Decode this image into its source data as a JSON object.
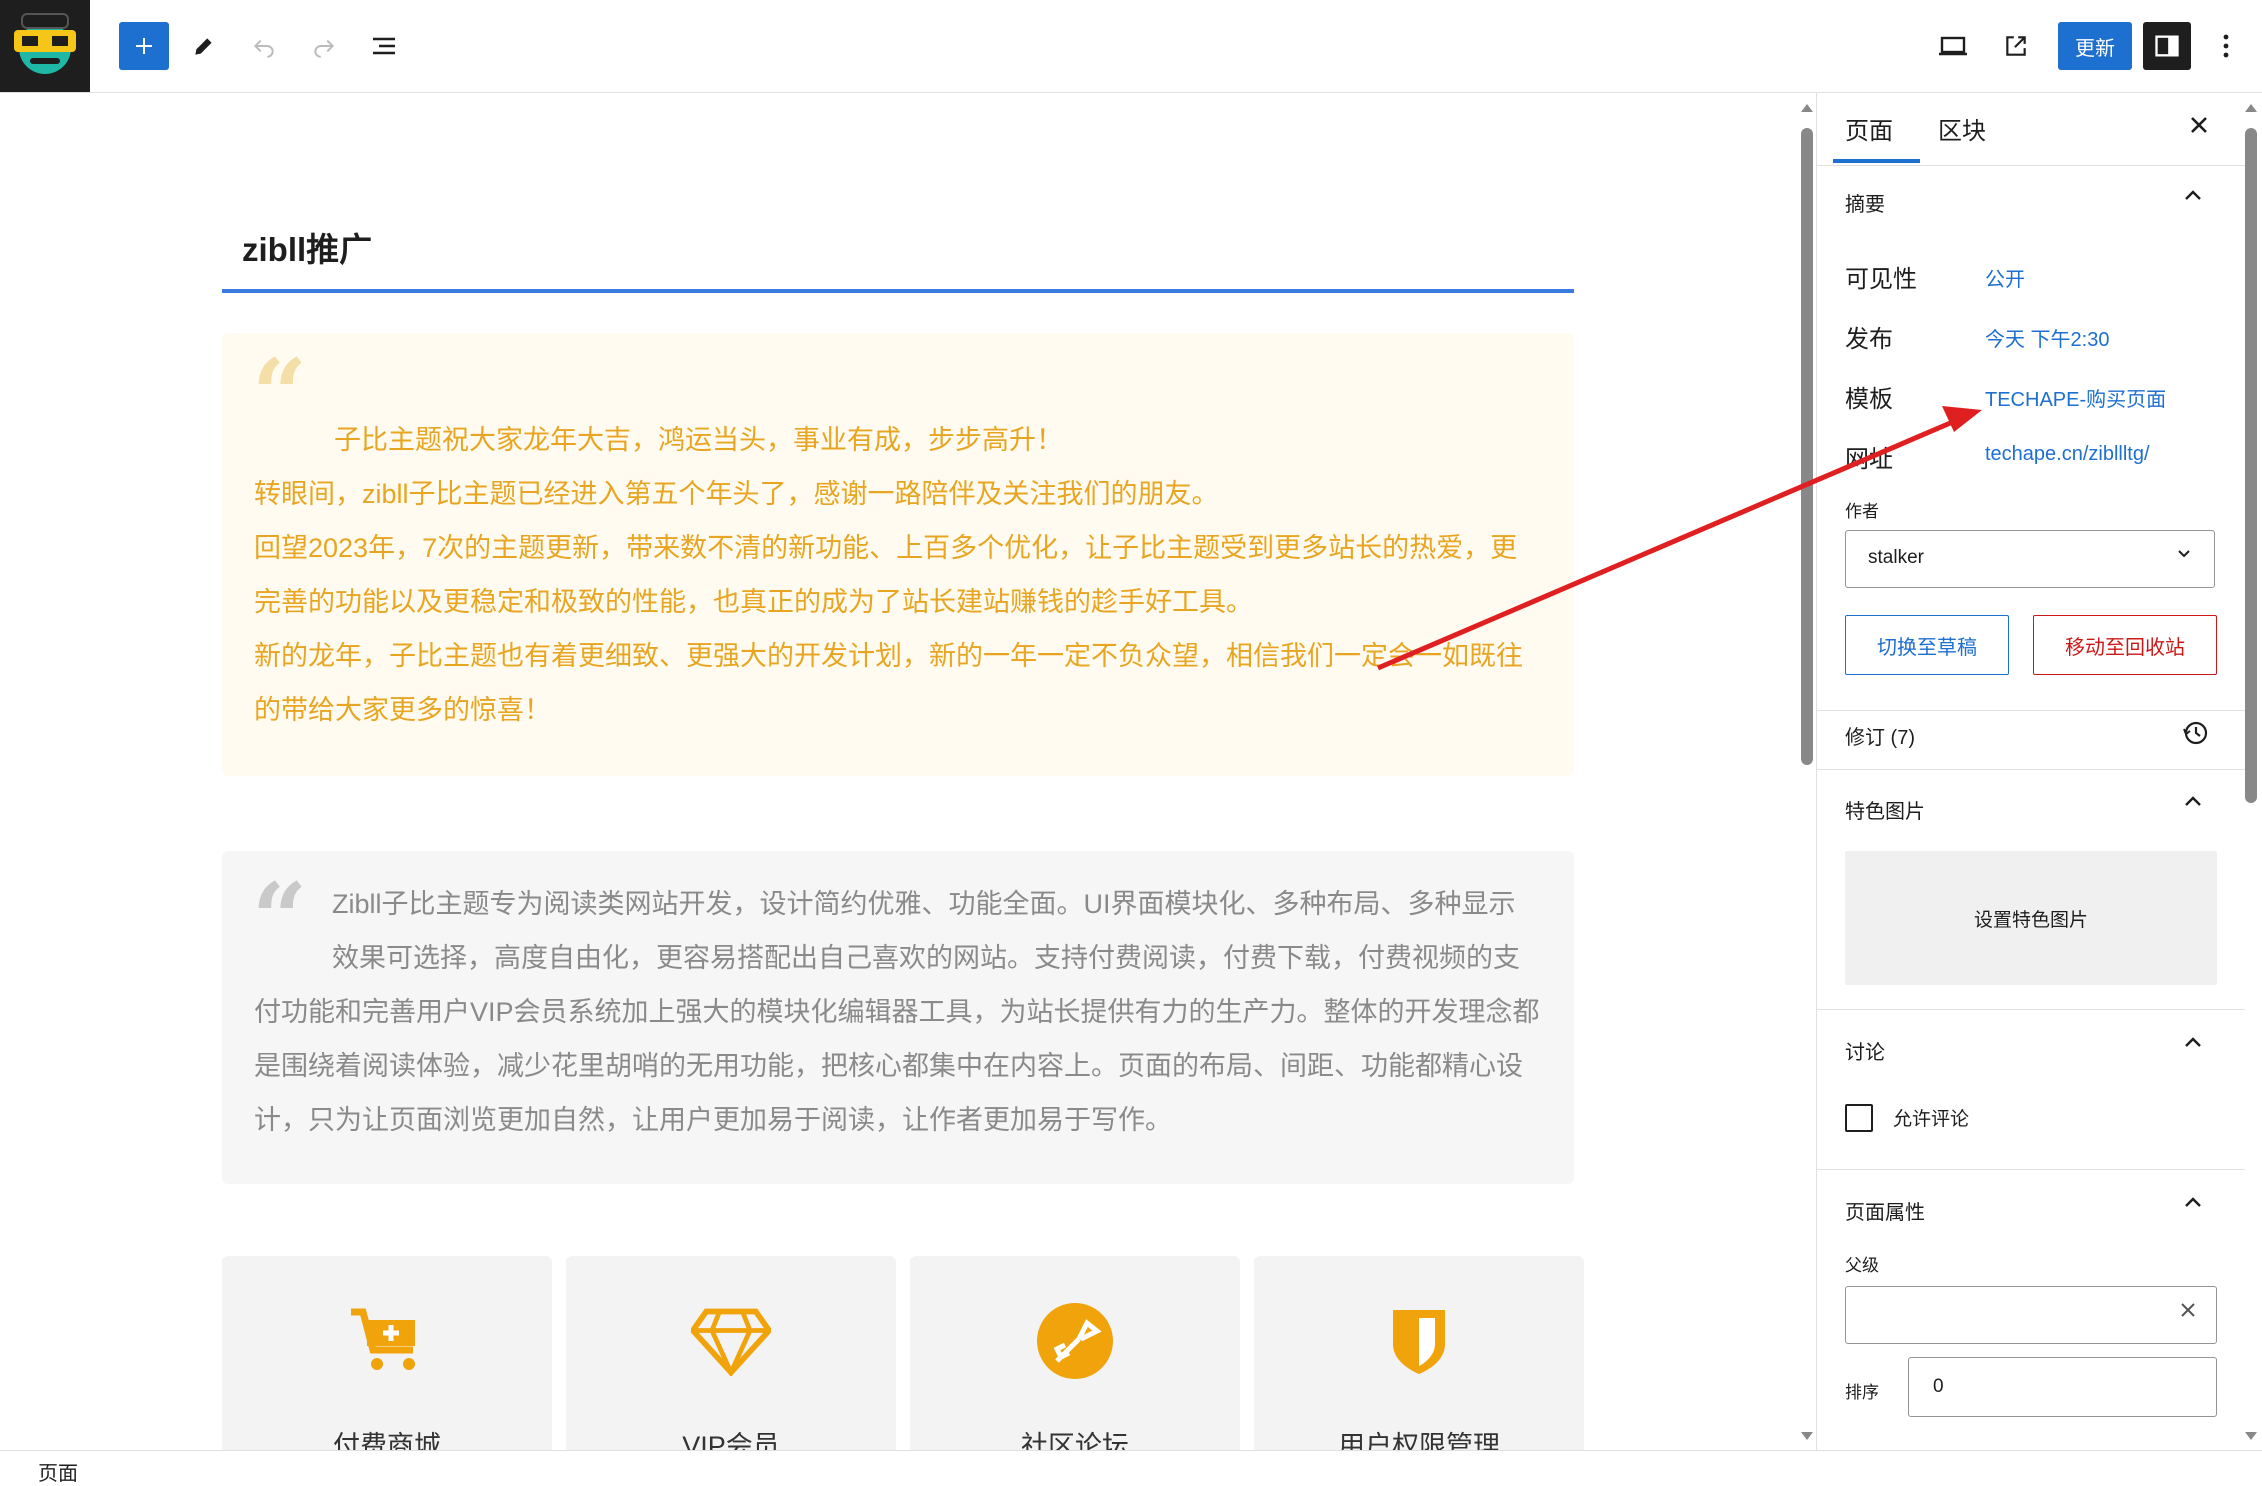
{
  "toolbar": {
    "add_icon": "plus-icon",
    "tools_icon": "pencil-icon",
    "undo_icon": "undo-icon",
    "redo_icon": "redo-icon",
    "outline_icon": "list-view-icon",
    "view_icon": "desktop-view-icon",
    "preview_icon": "external-link-icon",
    "update_label": "更新",
    "settings_icon": "sidebar-toggle-icon",
    "more_icon": "more-vertical-icon",
    "accent": "#1d6fd0"
  },
  "editor": {
    "title": "zibll推广",
    "quote1": {
      "lines": [
        "子比主题祝大家龙年大吉，鸿运当头，事业有成，步步高升！",
        "转眼间，zibll子比主题已经进入第五个年头了，感谢一路陪伴及关注我们的朋友。",
        "回望2023年，7次的主题更新，带来数不清的新功能、上百多个优化，让子比主题受到更多站长的热爱，更",
        "完善的功能以及更稳定和极致的性能，也真正的成为了站长建站赚钱的趁手好工具。",
        "新的龙年，子比主题也有着更细致、更强大的开发计划，新的一年一定不负众望，相信我们一定会一如既往",
        "的带给大家更多的惊喜！"
      ],
      "color": "#e8a521"
    },
    "quote2": {
      "lines": [
        "Zibll子比主题专为阅读类网站开发，设计简约优雅、功能全面。UI界面模块化、多种布局、多种显示",
        "效果可选择，高度自由化，更容易搭配出自己喜欢的网站。支持付费阅读，付费下载，付费视频的支",
        "付功能和完善用户VIP会员系统加上强大的模块化编辑器工具，为站长提供有力的生产力。整体的开发理念都",
        "是围绕着阅读体验，减少花里胡哨的无用功能，把核心都集中在内容上。页面的布局、间距、功能都精心设",
        "计，只为让页面浏览更加自然，让用户更加易于阅读，让作者更加易于写作。"
      ]
    },
    "cards": [
      {
        "icon": "shopping-cart-icon",
        "label": "付费商城"
      },
      {
        "icon": "diamond-icon",
        "label": "VIP会员"
      },
      {
        "icon": "forum-icon",
        "label": "社区论坛"
      },
      {
        "icon": "shield-icon",
        "label": "用户权限管理"
      }
    ],
    "icon_color": "#f0a30a"
  },
  "sidebar": {
    "tabs": [
      "页面",
      "区块"
    ],
    "close_icon": "close-icon",
    "summary": {
      "heading": "摘要",
      "visibility_label": "可见性",
      "visibility_value": "公开",
      "publish_label": "发布",
      "publish_value": "今天 下午2:30",
      "template_label": "模板",
      "template_value": "TECHAPE-购买页面",
      "url_label": "网址",
      "url_value": "techape.cn/zibllltg/",
      "author_label": "作者",
      "author_value": "stalker",
      "draft_button": "切换至草稿",
      "trash_button": "移动至回收站"
    },
    "revisions": "修订 (7)",
    "featured_image": {
      "heading": "特色图片",
      "button": "设置特色图片"
    },
    "discussion": {
      "heading": "讨论",
      "allow_comments": "允许评论"
    },
    "page_attributes": {
      "heading": "页面属性",
      "parent_label": "父级",
      "order_label": "排序",
      "order_value": "0"
    }
  },
  "footer": {
    "breadcrumb": "页面"
  },
  "annotation": {
    "arrow_color": "#e02020"
  }
}
